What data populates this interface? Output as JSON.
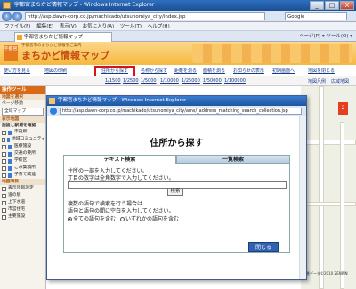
{
  "window": {
    "title": "宇都宮まちかど情報マップ - Windows Internet Explorer",
    "url": "http://asp.dawn-corp.co.jp/machikado/utsunomiya_city/index.jsp",
    "search_engine": "Google",
    "controls": {
      "min": "_",
      "max": "□",
      "close": "X"
    }
  },
  "menu": [
    "ファイル(F)",
    "編集(E)",
    "表示(V)",
    "お気に入り(A)",
    "ツール(T)",
    "ヘルプ(H)"
  ],
  "tab": {
    "label": "宇都宮まちかど情報マップ"
  },
  "toolbar_right": "ページ(P) ▾  ツール(O) ▾",
  "banner": {
    "title": "まちかど情報マップ",
    "subtitle": "宇都宮市のまちかど情報をご案内",
    "logo": "宇都宮"
  },
  "site_nav": {
    "left": [
      "使い方を見る",
      "地図の印刷"
    ],
    "links": [
      "住所から探す",
      "名称から探す",
      "距離を測る",
      "面積を測る",
      "お知らせの表示",
      "初期画面へ",
      "地図を閉じる"
    ]
  },
  "scale": {
    "items": [
      "1/1500",
      "1/2500",
      "1/5000",
      "1/10000",
      "1/25000",
      "1/50000",
      "1/100000"
    ],
    "extra": [
      "地図凡例",
      "広域地図"
    ]
  },
  "left_panel": {
    "header": "操作ツール",
    "sections": [
      "地図を選択",
      "ページ移動",
      "表示地図"
    ],
    "select_value": "全域マップ",
    "layers_header": "施設と駅場を確認",
    "layers": [
      "市役所",
      "地域コミュニティ",
      "医療施設",
      "交通の要所",
      "学校区",
      "ごみ集積所",
      "子育て関連"
    ],
    "sub_header": "地図項目",
    "items": [
      "表示項目設定",
      "道の駅",
      "上下水道",
      "市営住宅",
      "主要施設"
    ]
  },
  "popup": {
    "title": "宇都宮まちかど情報マップ - Windows Internet Explorer",
    "url": "http://asp.dawn-corp.co.jp/machikado/utsunomiya_city/ams/_address_matching_search_collection.jsp",
    "heading": "住所から探す",
    "tabs": [
      "テキスト検索",
      "一覧検索"
    ],
    "instructions": [
      "住所の一部を入力してください。",
      "丁目の数字は全角数字で入力してください。"
    ],
    "search_button": "検索",
    "multi_instructions": [
      "複数の語句で検索を行う場合は",
      "語句と語句の間に空白を入力してください。"
    ],
    "radio_all": "全ての語句を含む",
    "radio_any": "いずれかの語句を含む",
    "close_button": "閉じる"
  },
  "map": {
    "copyright": "背景データ©2010 ZENRIN"
  }
}
